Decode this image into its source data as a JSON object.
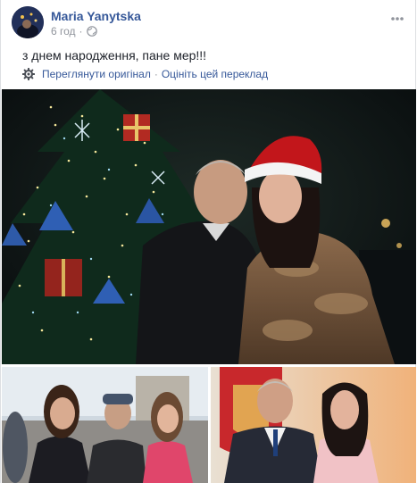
{
  "post": {
    "author": "Maria Yanytska",
    "time": "6 год",
    "separator": "·",
    "text": "з днем народження, пане мер!!!",
    "translation": {
      "view_original": "Переглянути оригінал",
      "separator": "·",
      "rate_translation": "Оцініть цей переклад"
    }
  },
  "icons": {
    "privacy": "globe-icon",
    "translation": "gear-icon",
    "menu": "more-options-icon"
  },
  "colors": {
    "link": "#365899",
    "muted": "#90949c",
    "text": "#1d2129"
  }
}
